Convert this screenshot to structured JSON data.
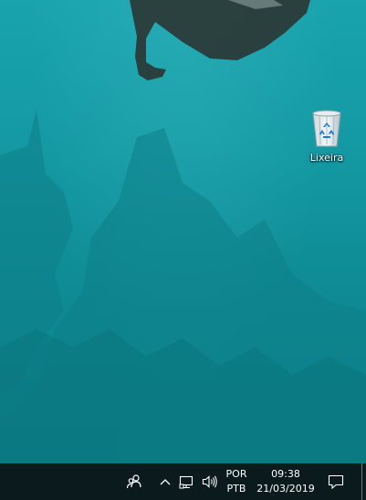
{
  "desktop": {
    "icons": [
      {
        "label": "Lixeira",
        "icon": "recycle-bin-icon"
      }
    ]
  },
  "taskbar": {
    "tray": {
      "people_icon": "people-icon",
      "overflow_icon": "chevron-up-icon",
      "network_icon": "network-icon",
      "volume_icon": "speaker-icon",
      "language": {
        "line1": "POR",
        "line2": "PTB"
      },
      "clock": {
        "time": "09:38",
        "date": "21/03/2019"
      },
      "notification_icon": "action-center-icon"
    }
  },
  "colors": {
    "wallpaper_top": "#19a3ad",
    "wallpaper_bottom": "#0c7f88",
    "taskbar": "#0b1a1d"
  }
}
